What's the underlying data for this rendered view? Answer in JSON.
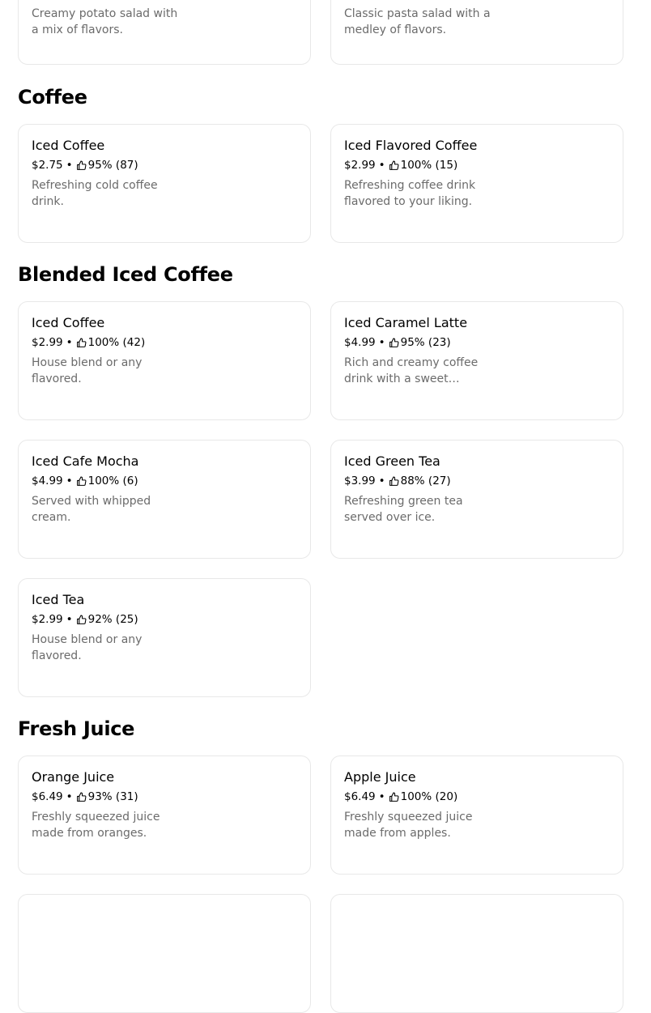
{
  "top_cards": [
    {
      "description": "Creamy potato salad with a mix of flavors."
    },
    {
      "description": "Classic pasta salad with a medley of flavors."
    }
  ],
  "sections": [
    {
      "title": "Coffee",
      "items": [
        {
          "name": "Iced Coffee",
          "price": "$2.75",
          "rating": "95% (87)",
          "description": "Refreshing cold coffee drink."
        },
        {
          "name": "Iced Flavored Coffee",
          "price": "$2.99",
          "rating": "100% (15)",
          "description": "Refreshing coffee drink flavored to your liking."
        }
      ]
    },
    {
      "title": "Blended Iced Coffee",
      "items": [
        {
          "name": "Iced Coffee",
          "price": "$2.99",
          "rating": "100% (42)",
          "description": "House blend or any flavored."
        },
        {
          "name": "Iced Caramel Latte",
          "price": "$4.99",
          "rating": "95% (23)",
          "description": "Rich and creamy coffee drink with a sweet caramel flavor."
        },
        {
          "name": "Iced Cafe Mocha",
          "price": "$4.99",
          "rating": "100% (6)",
          "description": "Served with whipped cream."
        },
        {
          "name": "Iced Green Tea",
          "price": "$3.99",
          "rating": "88% (27)",
          "description": "Refreshing green tea served over ice."
        },
        {
          "name": "Iced Tea",
          "price": "$2.99",
          "rating": "92% (25)",
          "description": "House blend or any flavored."
        }
      ]
    },
    {
      "title": "Fresh Juice",
      "items": [
        {
          "name": "Orange Juice",
          "price": "$6.49",
          "rating": "93% (31)",
          "description": "Freshly squeezed juice made from oranges."
        },
        {
          "name": "Apple Juice",
          "price": "$6.49",
          "rating": "100% (20)",
          "description": "Freshly squeezed juice made from apples."
        }
      ]
    }
  ],
  "separator": "•",
  "icons": {
    "rating": "thumbs-up-icon"
  }
}
